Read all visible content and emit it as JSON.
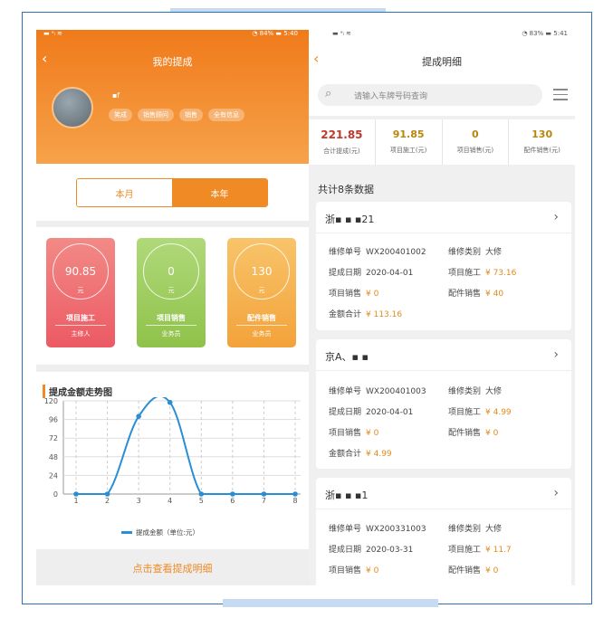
{
  "left": {
    "status": {
      "left": "▬ ᵃᵢ ≋",
      "right": "◔ 84% ▬ 5:40"
    },
    "title": "我的提成",
    "user": {
      "name": "▪f",
      "tags": [
        "笑成",
        "销售顾问",
        "销售",
        "全有信息"
      ]
    },
    "segments": {
      "month": "本月",
      "year": "本年",
      "active": "year"
    },
    "cards": [
      {
        "value": "90.85",
        "unit": "元",
        "label": "项目施工",
        "role": "主修人",
        "color_top": "#f28a86",
        "color_bottom": "#ec5a64"
      },
      {
        "value": "0",
        "unit": "元",
        "label": "项目销售",
        "role": "业务员",
        "color_top": "#b0d97a",
        "color_bottom": "#8fc24a"
      },
      {
        "value": "130",
        "unit": "元",
        "label": "配件销售",
        "role": "业务员",
        "color_top": "#f8c46a",
        "color_bottom": "#f3a23a"
      }
    ],
    "chart_title": "提成金额走势图",
    "detail_link": "点击查看提成明细"
  },
  "chart_data": {
    "type": "line",
    "title": "提成金额走势图",
    "categories": [
      "1",
      "2",
      "3",
      "4",
      "5",
      "6",
      "7",
      "8"
    ],
    "x": [
      1,
      2,
      3,
      4,
      5,
      6,
      7,
      8
    ],
    "series": [
      {
        "name": "提成金额（单位:元）",
        "values": [
          0,
          0,
          100,
          118,
          0,
          0,
          0,
          0
        ]
      }
    ],
    "yticks": [
      "0",
      "24",
      "48",
      "72",
      "96",
      "120"
    ],
    "ylim": [
      0,
      120
    ],
    "grid": true,
    "legend": "bottom",
    "color": "#2a8ed4"
  },
  "right": {
    "status": {
      "left": "▬ ᵃᵢ ≋",
      "right": "◔ 83% ▬ 5:41"
    },
    "title": "提成明细",
    "search_placeholder": "请输入车牌号码查询",
    "stats": [
      {
        "value": "221.85",
        "label": "合计提成(元)"
      },
      {
        "value": "91.85",
        "label": "项目施工(元)"
      },
      {
        "value": "0",
        "label": "项目销售(元)"
      },
      {
        "value": "130",
        "label": "配件销售(元)"
      }
    ],
    "count_label": "共计8条数据",
    "labels": {
      "order_no": "维修单号",
      "repair_type": "维修类别",
      "date": "提成日期",
      "construction": "项目施工",
      "project_sales": "项目销售",
      "parts_sales": "配件销售",
      "total": "金额合计"
    },
    "records": [
      {
        "plate": "浙▪ ▪ ▪21",
        "order_no": "WX200401002",
        "repair_type": "大修",
        "date": "2020-04-01",
        "construction": "¥ 73.16",
        "project_sales": "¥ 0",
        "parts_sales": "¥ 40",
        "total": "¥ 113.16"
      },
      {
        "plate": "京A、▪ ▪",
        "order_no": "WX200401003",
        "repair_type": "大修",
        "date": "2020-04-01",
        "construction": "¥ 4.99",
        "project_sales": "¥ 0",
        "parts_sales": "¥ 0",
        "total": "¥ 4.99"
      },
      {
        "plate": "浙▪ ▪ ▪1",
        "order_no": "WX200331003",
        "repair_type": "大修",
        "date": "2020-03-31",
        "construction": "¥ 11.7",
        "project_sales": "¥ 0",
        "parts_sales": "¥ 0"
      }
    ]
  }
}
